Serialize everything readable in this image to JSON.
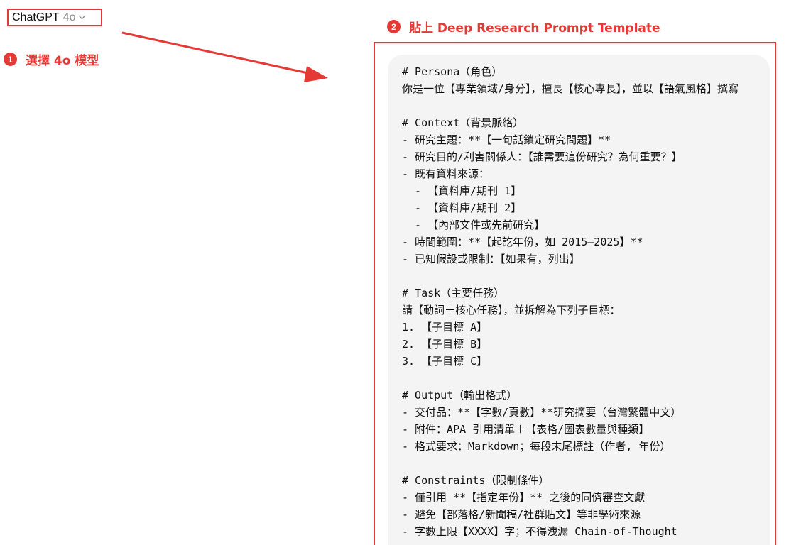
{
  "model_selector": {
    "name": "ChatGPT",
    "version": "4o",
    "chevron": "chevron-down-icon"
  },
  "annotations": {
    "step1": {
      "number": "1",
      "label": "選擇 4o 模型"
    },
    "step2": {
      "number": "2",
      "label": "貼上 Deep Research Prompt Template"
    },
    "accent_color": "#e53935"
  },
  "prompt": {
    "lines": [
      "# Persona（角色）",
      "你是一位【專業領域/身分】，擅長【核心專長】，並以【語氣風格】撰寫",
      "",
      "# Context（背景脈絡）",
      "- 研究主題：**【一句話鎖定研究問題】**",
      "- 研究目的/利害關係人：【誰需要這份研究？為何重要？】",
      "- 既有資料來源：",
      "  - 【資料庫/期刊 1】",
      "  - 【資料庫/期刊 2】",
      "  - 【內部文件或先前研究】",
      "- 時間範圍：**【起訖年份，如 2015–2025】**",
      "- 已知假設或限制：【如果有，列出】",
      "",
      "# Task（主要任務）",
      "請【動詞＋核心任務】，並拆解為下列子目標：",
      "1. 【子目標 A】",
      "2. 【子目標 B】",
      "3. 【子目標 C】",
      "",
      "# Output（輸出格式）",
      "- 交付品：**【字數/頁數】**研究摘要（台灣繁體中文）",
      "- 附件：APA 引用清單＋【表格/圖表數量與種類】",
      "- 格式要求：Markdown；每段末尾標註（作者, 年份）",
      "",
      "# Constraints（限制條件）",
      "- 僅引用 **【指定年份】** 之後的同儕審查文獻",
      "- 避免【部落格/新聞稿/社群貼文】等非學術來源",
      "- 字數上限【XXXX】字；不得洩漏 Chain-of-Thought"
    ]
  }
}
